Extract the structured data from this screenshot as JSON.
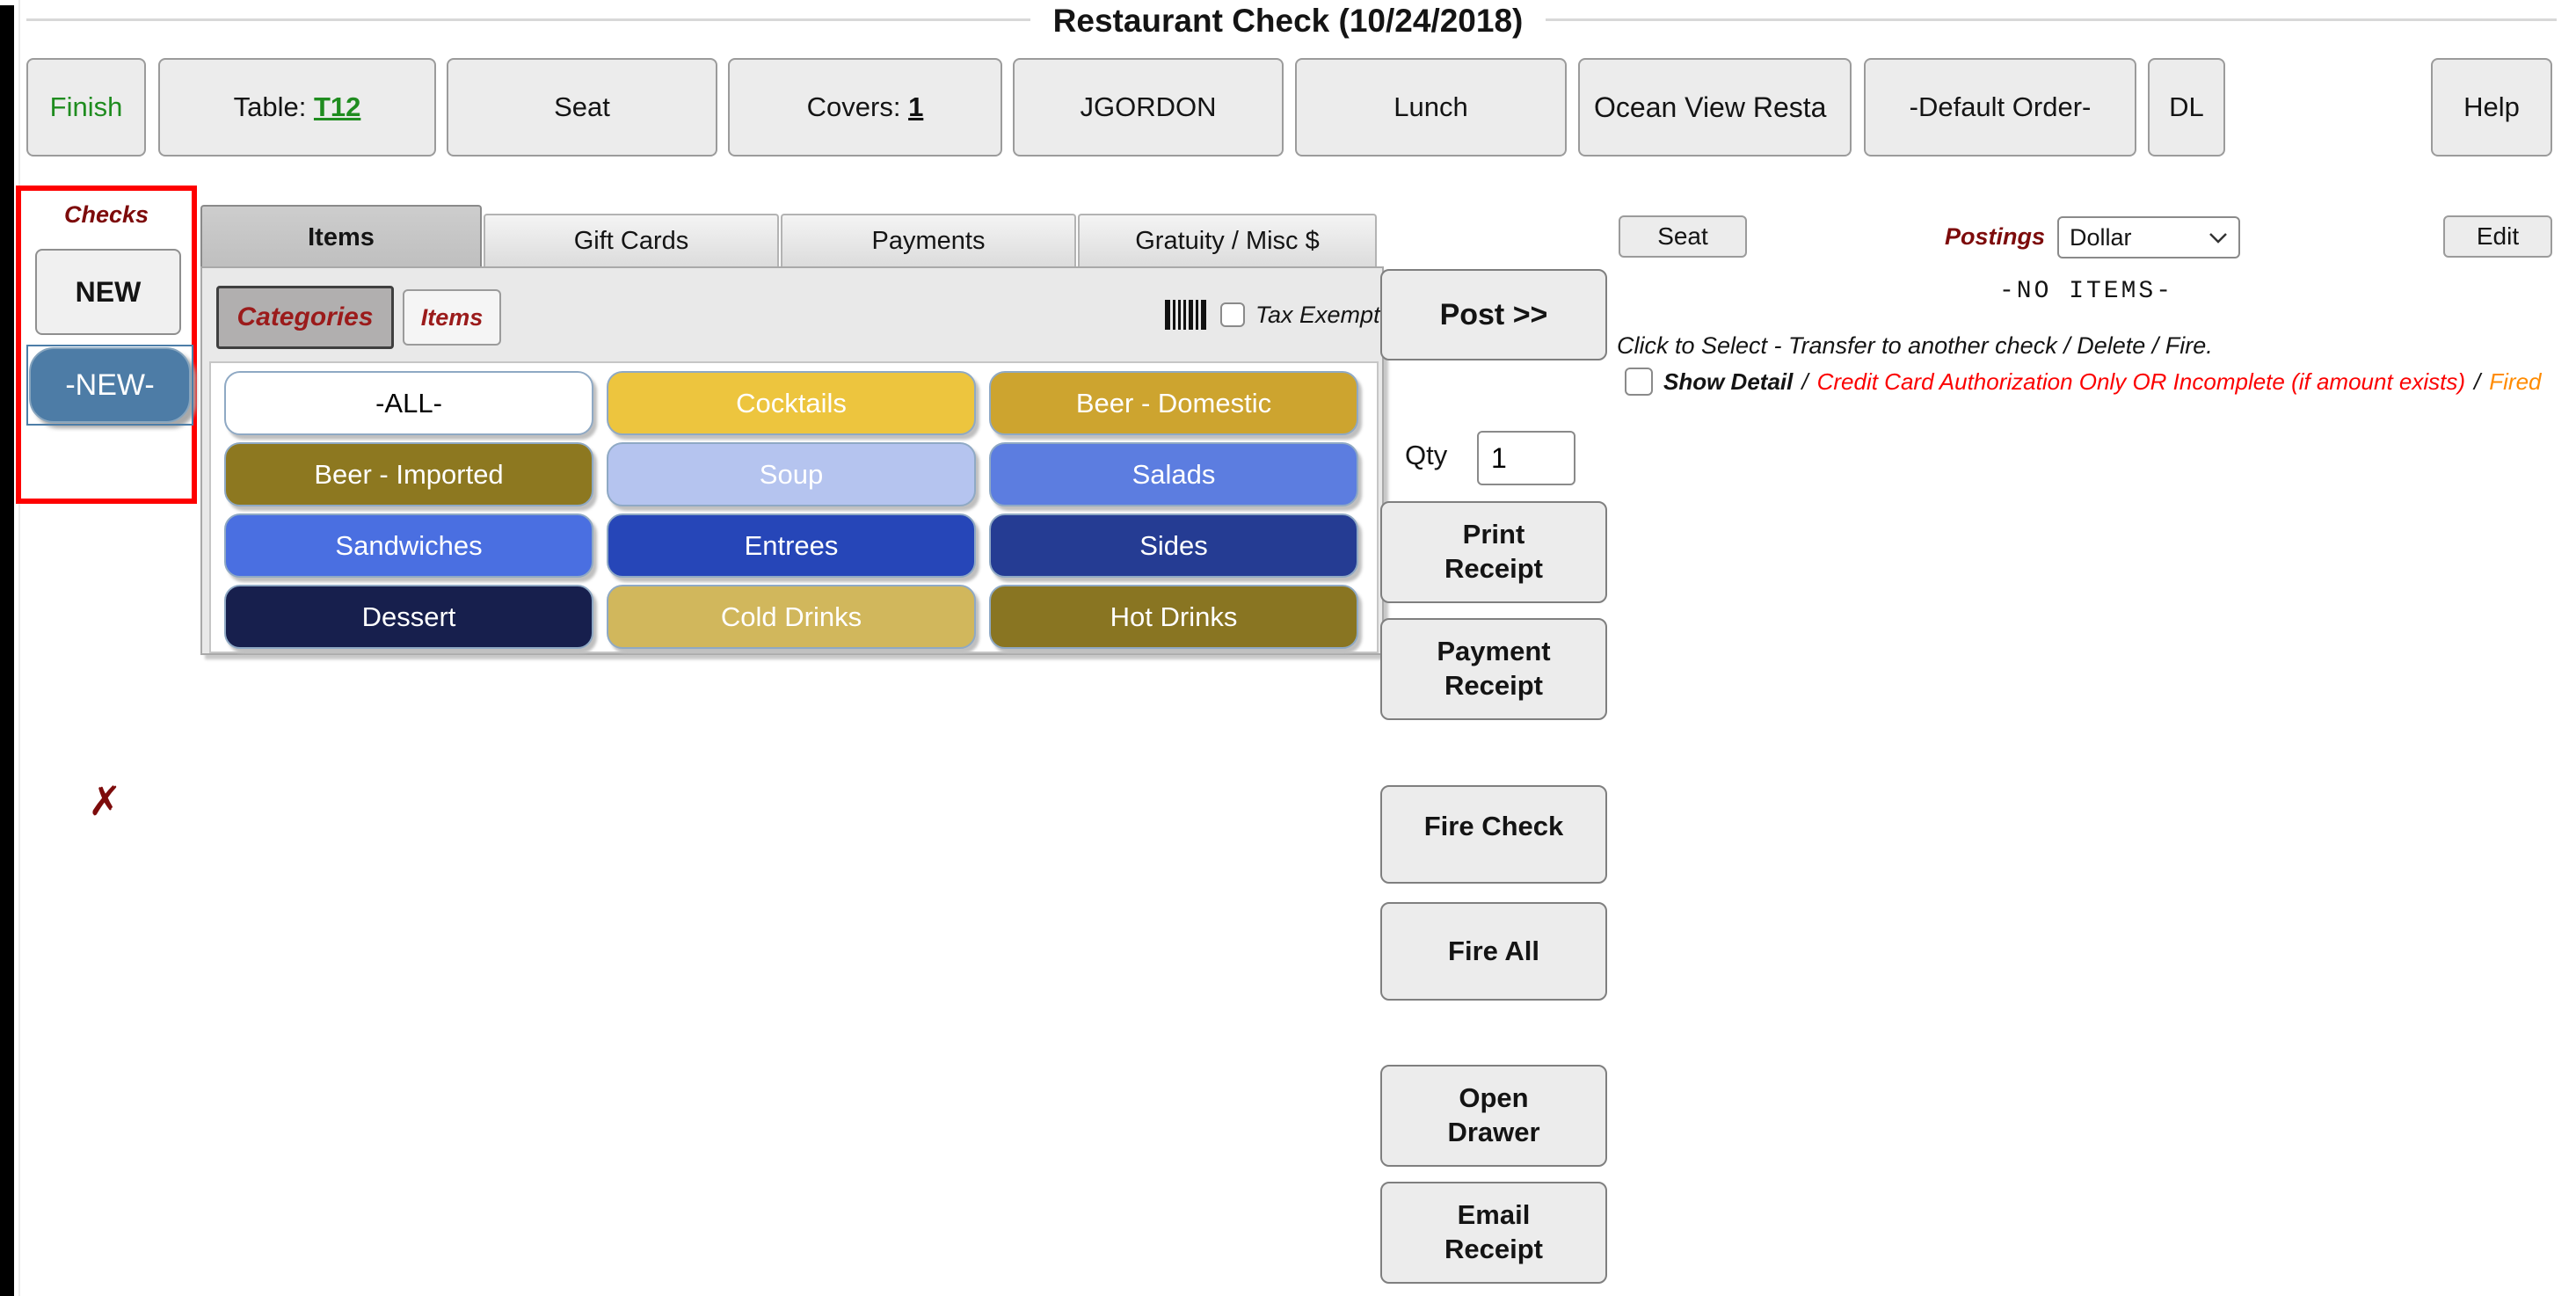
{
  "window": {
    "title": "Restaurant Check (10/24/2018)"
  },
  "colors": {
    "green": "#1f8c1f",
    "dark_red": "#7d0b0b",
    "highlight_red": "#fe0000",
    "selected_check_bg": "#4d7ca6",
    "credit_warning_red": "#fb0000",
    "fired_orange": "#ff8b00"
  },
  "toolbar": {
    "finish": "Finish",
    "table_prefix": "Table: ",
    "table_value": "T12",
    "seat": "Seat",
    "covers_prefix": "Covers: ",
    "covers_value": "1",
    "server": "JGORDON",
    "meal_period": "Lunch",
    "restaurant": "Ocean View Resta",
    "order_type": "-Default Order-",
    "dl": "DL",
    "help": "Help"
  },
  "checks_panel": {
    "title": "Checks",
    "new_button": "NEW",
    "selected_check": "-NEW-",
    "delete_mark": "✗"
  },
  "tabs": [
    {
      "label": "Items",
      "active": true
    },
    {
      "label": "Gift Cards",
      "active": false
    },
    {
      "label": "Payments",
      "active": false
    },
    {
      "label": "Gratuity / Misc $",
      "active": false
    }
  ],
  "items_tab": {
    "categories_button": "Categories",
    "items_button": "Items",
    "barcode_icon": "barcode-icon",
    "tax_exempt_label": "Tax Exempt",
    "tax_exempt_checked": false,
    "categories": [
      {
        "label": "-ALL-",
        "bg": "#ffffff",
        "fg": "#000000"
      },
      {
        "label": "Cocktails",
        "bg": "#edc53e",
        "fg": "#ffffff"
      },
      {
        "label": "Beer - Domestic",
        "bg": "#cda42f",
        "fg": "#ffffff"
      },
      {
        "label": "Beer - Imported",
        "bg": "#8d7820",
        "fg": "#ffffff"
      },
      {
        "label": "Soup",
        "bg": "#b5c4ef",
        "fg": "#ffffff"
      },
      {
        "label": "Salads",
        "bg": "#5c7de0",
        "fg": "#ffffff"
      },
      {
        "label": "Sandwiches",
        "bg": "#4a6fe1",
        "fg": "#ffffff"
      },
      {
        "label": "Entrees",
        "bg": "#2646b8",
        "fg": "#ffffff"
      },
      {
        "label": "Sides",
        "bg": "#253c93",
        "fg": "#ffffff"
      },
      {
        "label": "Dessert",
        "bg": "#171f4d",
        "fg": "#ffffff"
      },
      {
        "label": "Cold Drinks",
        "bg": "#d1b75c",
        "fg": "#ffffff"
      },
      {
        "label": "Hot Drinks",
        "bg": "#897522",
        "fg": "#ffffff"
      }
    ]
  },
  "actions": {
    "post": "Post >>",
    "qty_label": "Qty",
    "qty_value": "1",
    "print_receipt": "Print\nReceipt",
    "payment_receipt": "Payment\nReceipt",
    "fire_check": "Fire Check",
    "fire_all": "Fire All",
    "open_drawer": "Open\nDrawer",
    "email_receipt": "Email\nReceipt"
  },
  "check_detail": {
    "seat_button": "Seat",
    "postings_label": "Postings",
    "postings_selected": "Dollar",
    "chevron_icon": "chevron-down-icon",
    "edit_button": "Edit",
    "empty_message": "-NO ITEMS-",
    "hint": "Click to Select - Transfer to another check / Delete / Fire.",
    "show_detail_label": "Show Detail",
    "show_detail_checked": false,
    "sep1": "/",
    "legend_credit": "Credit Card Authorization Only OR Incomplete (if amount exists)",
    "sep2": "/",
    "legend_fired": "Fired"
  }
}
